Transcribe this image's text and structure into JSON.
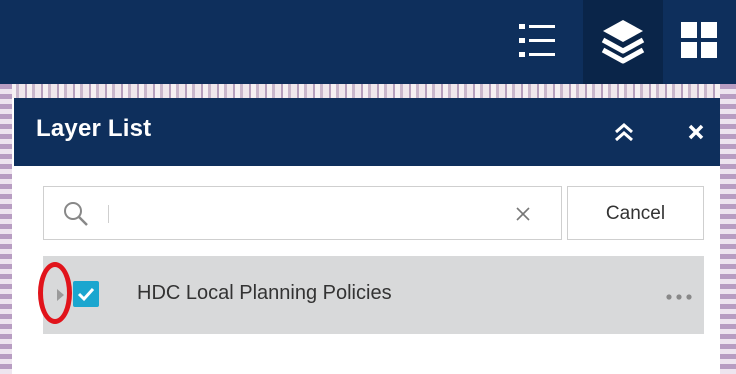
{
  "toolbar": {
    "buttons": [
      {
        "name": "legend",
        "icon": "legend-list-icon"
      },
      {
        "name": "layer-list",
        "icon": "layers-stack-icon",
        "active": true
      },
      {
        "name": "apps",
        "icon": "grid-icon"
      }
    ],
    "color": "#0e2f5c"
  },
  "panel": {
    "title": "Layer List",
    "collapse_icon": "double-chevron-up-icon",
    "close_icon": "close-icon",
    "search": {
      "value": "",
      "placeholder": "",
      "cancel_label": "Cancel"
    },
    "layers": [
      {
        "label": "HDC Local Planning Policies",
        "checked": true,
        "expanded": false,
        "checkbox_color": "#1ba6cf"
      }
    ]
  },
  "annotation": {
    "shape": "oval",
    "color": "#e1141b",
    "target": "layer-expand-toggle"
  }
}
